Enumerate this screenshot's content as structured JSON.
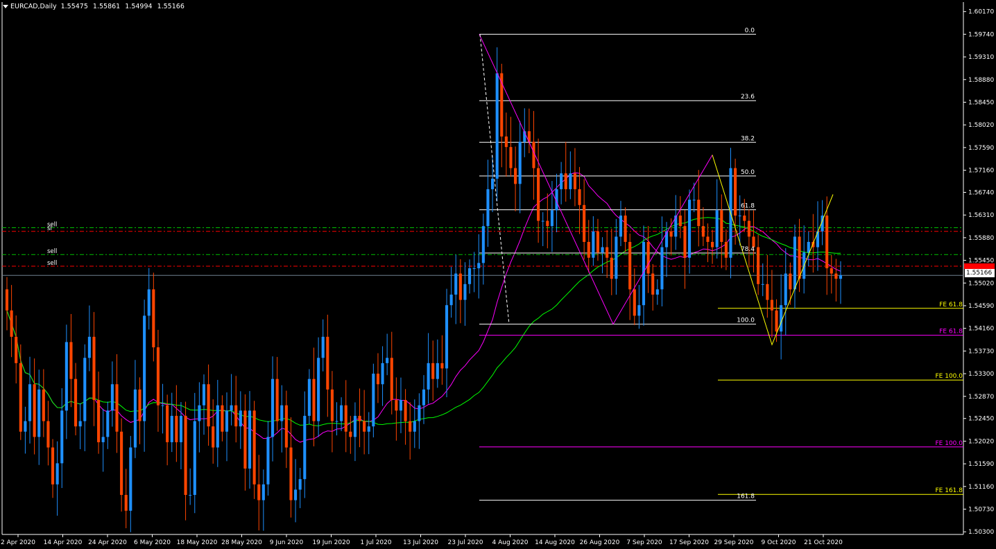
{
  "header": {
    "symbol_timeframe": "EURCAD,Daily",
    "open": "1.55475",
    "high": "1.55861",
    "low": "1.54994",
    "close": "1.55166"
  },
  "price_axis": {
    "ticks": [
      "1.60170",
      "1.59740",
      "1.59310",
      "1.58880",
      "1.58450",
      "1.58020",
      "1.57590",
      "1.57160",
      "1.56740",
      "1.56310",
      "1.55880",
      "1.55450",
      "1.55020",
      "1.54590",
      "1.54160",
      "1.53730",
      "1.53300",
      "1.52870",
      "1.52450",
      "1.52020",
      "1.51590",
      "1.51160",
      "1.50730",
      "1.50300"
    ],
    "current_price": "1.55166"
  },
  "time_axis": {
    "labels": [
      "2 Apr 2020",
      "14 Apr 2020",
      "24 Apr 2020",
      "6 May 2020",
      "18 May 2020",
      "28 May 2020",
      "9 Jun 2020",
      "19 Jun 2020",
      "1 Jul 2020",
      "13 Jul 2020",
      "23 Jul 2020",
      "4 Aug 2020",
      "14 Aug 2020",
      "26 Aug 2020",
      "7 Sep 2020",
      "17 Sep 2020",
      "29 Sep 2020",
      "9 Oct 2020",
      "21 Oct 2020"
    ]
  },
  "fibonacci_retracement": {
    "levels": [
      {
        "label": "0.0",
        "price": 1.5974
      },
      {
        "label": "23.6",
        "price": 1.5848
      },
      {
        "label": "38.2",
        "price": 1.5769
      },
      {
        "label": "50.0",
        "price": 1.5705
      },
      {
        "label": "61.8",
        "price": 1.5641
      },
      {
        "label": "78.4",
        "price": 1.5559
      },
      {
        "label": "100.0",
        "price": 1.5424
      },
      {
        "label": "161.8",
        "price": 1.509
      }
    ],
    "color": "#ffffff"
  },
  "fibonacci_expansion_yellow": {
    "levels": [
      {
        "label": "FE 61.8",
        "price": 1.5454
      },
      {
        "label": "FE 100.0",
        "price": 1.5318
      },
      {
        "label": "FE 161.8",
        "price": 1.5101
      }
    ],
    "color": "#ffff00"
  },
  "fibonacci_expansion_magenta": {
    "levels": [
      {
        "label": "FE 61.8",
        "price": 1.5403
      },
      {
        "label": "FE 100.0",
        "price": 1.5191
      }
    ],
    "color": "#ff00ff"
  },
  "order_levels": [
    {
      "label": "sell",
      "price": 1.5607,
      "color": "#00c000"
    },
    {
      "label": "sl",
      "price": 1.56,
      "color": "#ff0000"
    },
    {
      "label": "sell",
      "price": 1.5556,
      "color": "#00c000"
    },
    {
      "label": "sell",
      "price": 1.5534,
      "color": "#ff0000"
    }
  ],
  "colors": {
    "bull_candle": "#1e90ff",
    "bear_candle": "#ff4500",
    "ma_fast": "#00ff00",
    "ma_slow": "#ff00ff",
    "background": "#000000",
    "axis": "#ffffff"
  },
  "chart_data": {
    "type": "candlestick",
    "symbol": "EURCAD",
    "timeframe": "Daily",
    "ylim": [
      1.5025,
      1.6035
    ],
    "x_labels": [
      "2 Apr 2020",
      "14 Apr 2020",
      "24 Apr 2020",
      "6 May 2020",
      "18 May 2020",
      "28 May 2020",
      "9 Jun 2020",
      "19 Jun 2020",
      "1 Jul 2020",
      "13 Jul 2020",
      "23 Jul 2020",
      "4 Aug 2020",
      "14 Aug 2020",
      "26 Aug 2020",
      "7 Sep 2020",
      "17 Sep 2020",
      "29 Sep 2020",
      "9 Oct 2020",
      "21 Oct 2020"
    ],
    "price_path": [
      1.545,
      1.54,
      1.535,
      1.522,
      1.524,
      1.531,
      1.521,
      1.53,
      1.524,
      1.519,
      1.512,
      1.516,
      1.526,
      1.539,
      1.532,
      1.523,
      1.524,
      1.536,
      1.54,
      1.528,
      1.52,
      1.521,
      1.526,
      1.531,
      1.522,
      1.51,
      1.507,
      1.519,
      1.53,
      1.524,
      1.544,
      1.549,
      1.538,
      1.527,
      1.527,
      1.52,
      1.525,
      1.52,
      1.525,
      1.51,
      1.51,
      1.524,
      1.527,
      1.531,
      1.523,
      1.519,
      1.527,
      1.522,
      1.526,
      1.527,
      1.523,
      1.526,
      1.515,
      1.526,
      1.512,
      1.509,
      1.512,
      1.521,
      1.532,
      1.524,
      1.527,
      1.519,
      1.509,
      1.511,
      1.513,
      1.525,
      1.532,
      1.524,
      1.536,
      1.54,
      1.53,
      1.524,
      1.524,
      1.527,
      1.522,
      1.521,
      1.525,
      1.524,
      1.522,
      1.523,
      1.533,
      1.531,
      1.535,
      1.536,
      1.528,
      1.526,
      1.528,
      1.524,
      1.522,
      1.524,
      1.527,
      1.53,
      1.535,
      1.532,
      1.535,
      1.534,
      1.546,
      1.548,
      1.552,
      1.547,
      1.55,
      1.553,
      1.553,
      1.554,
      1.561,
      1.568,
      1.57,
      1.59,
      1.578,
      1.576,
      1.572,
      1.569,
      1.577,
      1.579,
      1.577,
      1.572,
      1.562,
      1.562,
      1.561,
      1.564,
      1.568,
      1.571,
      1.568,
      1.571,
      1.568,
      1.565,
      1.558,
      1.555,
      1.56,
      1.556,
      1.557,
      1.555,
      1.551,
      1.559,
      1.563,
      1.558,
      1.549,
      1.544,
      1.546,
      1.558,
      1.552,
      1.548,
      1.549,
      1.557,
      1.56,
      1.559,
      1.563,
      1.561,
      1.555,
      1.566,
      1.566,
      1.561,
      1.559,
      1.558,
      1.557,
      1.564,
      1.558,
      1.555,
      1.572,
      1.563,
      1.563,
      1.562,
      1.559,
      1.557,
      1.55,
      1.55,
      1.547,
      1.545,
      1.541,
      1.546,
      1.552,
      1.549,
      1.559,
      1.551,
      1.556,
      1.558,
      1.557,
      1.56,
      1.563,
      1.553,
      1.552,
      1.551,
      1.5517
    ]
  }
}
